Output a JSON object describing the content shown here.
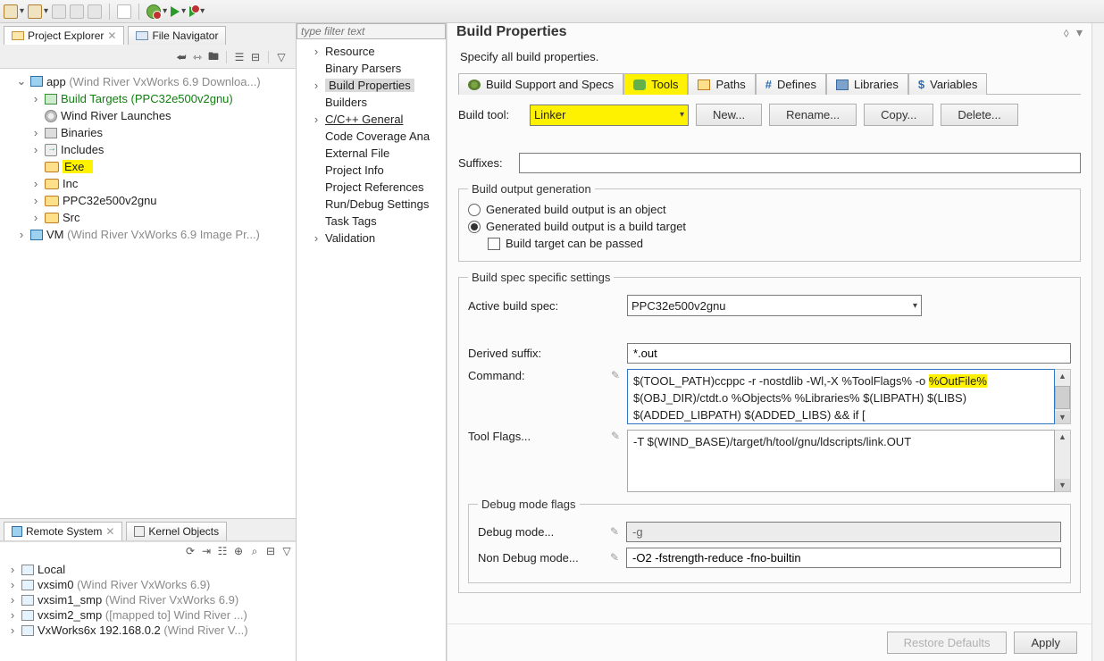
{
  "topToolbar": {
    "save": "",
    "saveAll": "",
    "showIn": ""
  },
  "projectExplorer": {
    "tabLabel": "Project Explorer",
    "secondTabLabel": "File Navigator",
    "tree": {
      "project": {
        "name": "app",
        "annotation": "(Wind River VxWorks 6.9 Downloa...)"
      },
      "buildTargets": {
        "label": "Build Targets",
        "spec": "(PPC32e500v2gnu)"
      },
      "windRiverLaunches": "Wind River Launches",
      "binaries": "Binaries",
      "includes": "Includes",
      "exe": "Exe",
      "inc": "Inc",
      "spec": "PPC32e500v2gnu",
      "src": "Src",
      "vm": {
        "name": "VM",
        "annotation": "(Wind River VxWorks 6.9 Image Pr...)"
      }
    }
  },
  "remoteSystems": {
    "tabLabel": "Remote System",
    "kernelTabLabel": "Kernel Objects",
    "items": [
      {
        "name": "Local",
        "ann": ""
      },
      {
        "name": "vxsim0",
        "ann": "(Wind River VxWorks 6.9)"
      },
      {
        "name": "vxsim1_smp",
        "ann": "(Wind River VxWorks 6.9)"
      },
      {
        "name": "vxsim2_smp",
        "ann": "([mapped to] Wind River ...)"
      },
      {
        "name": "VxWorks6x  192.168.0.2",
        "ann": "(Wind River V...)"
      }
    ]
  },
  "propTree": {
    "filterPlaceholder": "type filter text",
    "items": {
      "resource": "Resource",
      "binaryParsers": "Binary Parsers",
      "buildProperties": "Build Properties",
      "builders": "Builders",
      "cpp": "C/C++ General",
      "coverage": "Code Coverage Ana",
      "externalFile": "External File",
      "projectInfo": "Project Info",
      "projectRefs": "Project References",
      "runDebug": "Run/Debug Settings",
      "taskTags": "Task Tags",
      "validation": "Validation"
    }
  },
  "page": {
    "title": "Build Properties",
    "desc": "Specify all build properties.",
    "tabs": {
      "support": "Build Support and Specs",
      "tools": "Tools",
      "paths": "Paths",
      "defines": "Defines",
      "libraries": "Libraries",
      "variables": "Variables"
    },
    "buildToolLabel": "Build tool:",
    "buildToolValue": "Linker",
    "buttons": {
      "new": "New...",
      "rename": "Rename...",
      "copy": "Copy...",
      "delete": "Delete..."
    },
    "suffixesLabel": "Suffixes:",
    "suffixesValue": "",
    "buildOutput": {
      "legend": "Build output generation",
      "optObject": "Generated build output is an object",
      "optTarget": "Generated build output is a build target",
      "checkPassed": "Build target can be passed"
    },
    "spec": {
      "legend": "Build spec specific settings",
      "activeLabel": "Active build spec:",
      "activeValue": "PPC32e500v2gnu",
      "derivedSuffixLabel": "Derived suffix:",
      "derivedSuffixValue": "*.out",
      "commandLabel": "Command:",
      "commandLine1": "$(TOOL_PATH)ccppc -r -nostdlib -Wl,-X %ToolFlags% -o",
      "commandHighlighted": "%OutFile%",
      "commandLine2": " $(OBJ_DIR)/ctdt.o %Objects% %Libraries% $(LIBPATH) $(LIBS) $(ADDED_LIBPATH) $(ADDED_LIBS) && if [",
      "toolFlagsLabel": "Tool Flags...",
      "toolFlagsValue": "-T $(WIND_BASE)/target/h/tool/gnu/ldscripts/link.OUT"
    },
    "debug": {
      "legend": "Debug mode flags",
      "debugModeLabel": "Debug mode...",
      "debugModeValue": "-g",
      "nonDebugLabel": "Non Debug mode...",
      "nonDebugValue": "-O2 -fstrength-reduce -fno-builtin"
    },
    "footer": {
      "restore": "Restore Defaults",
      "apply": "Apply"
    }
  }
}
